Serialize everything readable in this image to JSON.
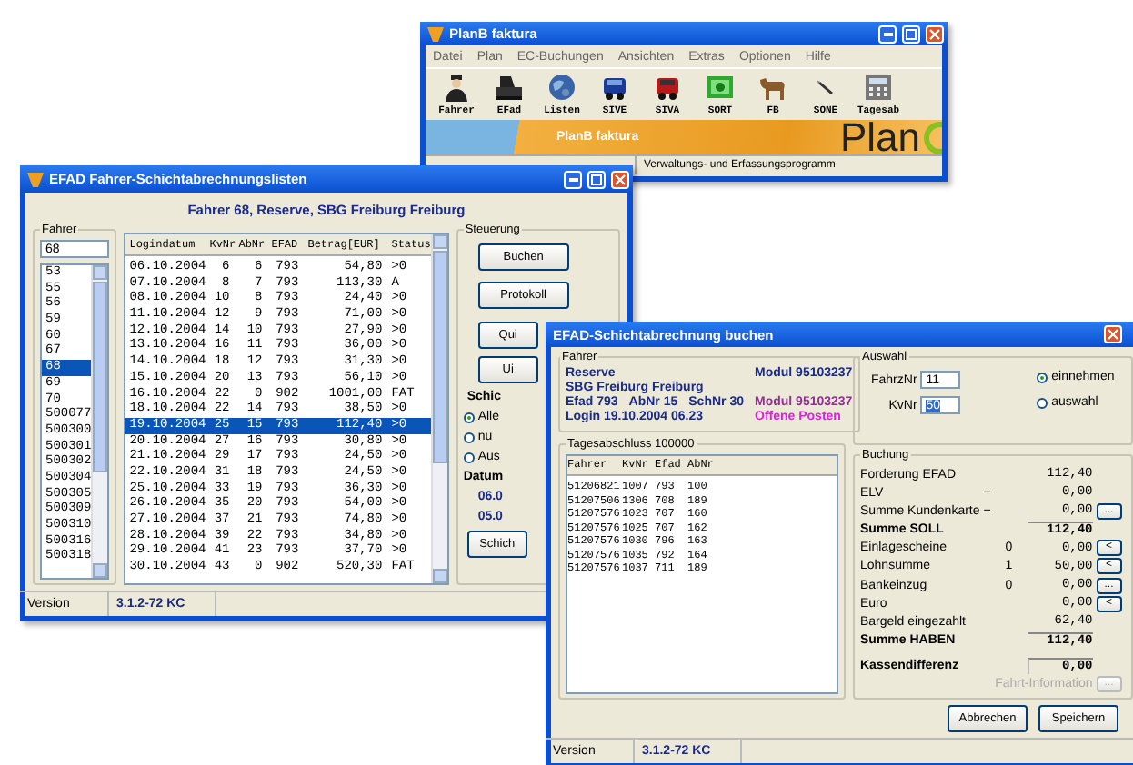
{
  "main_window": {
    "title": "PlanB faktura",
    "menu": [
      "Datei",
      "Plan",
      "EC-Buchungen",
      "Ansichten",
      "Extras",
      "Optionen",
      "Hilfe"
    ],
    "toolbar": [
      "Fahrer",
      "EFad",
      "Listen",
      "SIVE",
      "SIVA",
      "SORT",
      "FB",
      "SONE",
      "Tagesab"
    ],
    "banner_title": "PlanB faktura",
    "logo": "Plan",
    "status_text": "Verwaltungs- und Erfassungsprogramm"
  },
  "list_window": {
    "title": "EFAD Fahrer-Schichtabrechnungslisten",
    "header": "Fahrer 68,  Reserve, SBG Freiburg Freiburg",
    "driver_group": {
      "label": "Fahrer",
      "value": "68",
      "items": [
        {
          "label": "53",
          "selected": false
        },
        {
          "label": "55",
          "selected": false
        },
        {
          "label": "56",
          "selected": false
        },
        {
          "label": "59",
          "selected": false
        },
        {
          "label": "60",
          "selected": false
        },
        {
          "label": "67",
          "selected": false
        },
        {
          "label": "68",
          "selected": true
        },
        {
          "label": "69",
          "selected": false
        },
        {
          "label": "70",
          "selected": false
        },
        {
          "label": "500077",
          "selected": false
        },
        {
          "label": "500300",
          "selected": false
        },
        {
          "label": "500301",
          "selected": false
        },
        {
          "label": "500302",
          "selected": false
        },
        {
          "label": "500304",
          "selected": false
        },
        {
          "label": "500305",
          "selected": false
        },
        {
          "label": "500309",
          "selected": false
        },
        {
          "label": "500310",
          "selected": false
        },
        {
          "label": "500316",
          "selected": false
        },
        {
          "label": "500318",
          "selected": false
        }
      ]
    },
    "table": {
      "columns": [
        "Logindatum",
        "KvNr",
        "AbNr",
        "EFAD",
        "Betrag[EUR]",
        "Status"
      ],
      "rows": [
        {
          "cells": [
            "06.10.2004",
            "6",
            "6",
            "793",
            "54,80",
            ">0"
          ],
          "selected": false
        },
        {
          "cells": [
            "07.10.2004",
            "8",
            "7",
            "793",
            "113,30",
            "A"
          ],
          "selected": false
        },
        {
          "cells": [
            "08.10.2004",
            "10",
            "8",
            "793",
            "24,40",
            ">0"
          ],
          "selected": false
        },
        {
          "cells": [
            "11.10.2004",
            "12",
            "9",
            "793",
            "71,00",
            ">0"
          ],
          "selected": false
        },
        {
          "cells": [
            "12.10.2004",
            "14",
            "10",
            "793",
            "27,90",
            ">0"
          ],
          "selected": false
        },
        {
          "cells": [
            "13.10.2004",
            "16",
            "11",
            "793",
            "36,00",
            ">0"
          ],
          "selected": false
        },
        {
          "cells": [
            "14.10.2004",
            "18",
            "12",
            "793",
            "31,30",
            ">0"
          ],
          "selected": false
        },
        {
          "cells": [
            "15.10.2004",
            "20",
            "13",
            "793",
            "56,10",
            ">0"
          ],
          "selected": false
        },
        {
          "cells": [
            "16.10.2004",
            "22",
            "0",
            "902",
            "1001,00",
            "FAT"
          ],
          "selected": false
        },
        {
          "cells": [
            "18.10.2004",
            "22",
            "14",
            "793",
            "38,50",
            ">0"
          ],
          "selected": false
        },
        {
          "cells": [
            "19.10.2004",
            "25",
            "15",
            "793",
            "112,40",
            ">0"
          ],
          "selected": true
        },
        {
          "cells": [
            "20.10.2004",
            "27",
            "16",
            "793",
            "30,80",
            ">0"
          ],
          "selected": false
        },
        {
          "cells": [
            "21.10.2004",
            "29",
            "17",
            "793",
            "24,50",
            ">0"
          ],
          "selected": false
        },
        {
          "cells": [
            "22.10.2004",
            "31",
            "18",
            "793",
            "24,50",
            ">0"
          ],
          "selected": false
        },
        {
          "cells": [
            "25.10.2004",
            "33",
            "19",
            "793",
            "36,30",
            ">0"
          ],
          "selected": false
        },
        {
          "cells": [
            "26.10.2004",
            "35",
            "20",
            "793",
            "54,00",
            ">0"
          ],
          "selected": false
        },
        {
          "cells": [
            "27.10.2004",
            "37",
            "21",
            "793",
            "74,80",
            ">0"
          ],
          "selected": false
        },
        {
          "cells": [
            "28.10.2004",
            "39",
            "22",
            "793",
            "34,80",
            ">0"
          ],
          "selected": false
        },
        {
          "cells": [
            "29.10.2004",
            "41",
            "23",
            "793",
            "37,70",
            ">0"
          ],
          "selected": false
        },
        {
          "cells": [
            "30.10.2004",
            "43",
            "0",
            "902",
            "520,30",
            "FAT"
          ],
          "selected": false
        }
      ]
    },
    "control_group": {
      "label": "Steuerung",
      "buttons": [
        "Buchen",
        "Protokoll",
        "Qui",
        "Ui"
      ],
      "filter_label": "Schic",
      "filter_options": [
        {
          "label": "Alle",
          "selected": true
        },
        {
          "label": "nu",
          "selected": false
        },
        {
          "label": "Aus",
          "selected": false
        }
      ],
      "date_label": "Datum",
      "dates": [
        "06.0",
        "05.0"
      ],
      "bottom_button": "Schich"
    },
    "status": {
      "label": "Version",
      "version": "3.1.2-72 KC"
    }
  },
  "booking_window": {
    "title": "EFAD-Schichtabrechnung buchen",
    "driver_group": {
      "label": "Fahrer",
      "name": "Reserve",
      "company": "SBG Freiburg Freiburg",
      "details": [
        "Efad 793",
        "AbNr 15",
        "SchNr 30"
      ],
      "login": "Login  19.10.2004  06.23",
      "module": "Modul 95103237",
      "module_2": "Modul 95103237",
      "open_items": "Offene Posten"
    },
    "shift_group": {
      "label": "Tagesabschluss 100000",
      "columns": [
        "Fahrer",
        "KvNr",
        "Efad",
        "AbNr"
      ],
      "rows": [
        [
          "51206821",
          "1007",
          "793",
          "100"
        ],
        [
          "51207506",
          "1306",
          "708",
          "189"
        ],
        [
          "51207576",
          "1023",
          "707",
          "160"
        ],
        [
          "51207576",
          "1025",
          "707",
          "162"
        ],
        [
          "51207576",
          "1030",
          "796",
          "163"
        ],
        [
          "51207576",
          "1035",
          "792",
          "164"
        ],
        [
          "51207576",
          "1037",
          "711",
          "189"
        ]
      ]
    },
    "selection_group": {
      "label": "Auswahl",
      "fields": [
        {
          "label": "FahrzNr",
          "value": "11",
          "highlighted": false
        },
        {
          "label": "KvNr",
          "value": "50",
          "highlighted": true
        }
      ],
      "options": [
        {
          "label": "einnehmen",
          "selected": true
        },
        {
          "label": "auswahl",
          "selected": false
        }
      ]
    },
    "booking_group": {
      "label": "Buchung",
      "rows": [
        {
          "kind": "line",
          "label": "Forderung EFAD",
          "sign": "",
          "count": "",
          "amount": "112,40",
          "action": ""
        },
        {
          "kind": "line",
          "label": "ELV",
          "sign": "−",
          "count": "",
          "amount": "0,00",
          "action": ""
        },
        {
          "kind": "line",
          "label": "Summe Kundenkarte",
          "sign": "−",
          "count": "",
          "amount": "0,00",
          "action": "..."
        },
        {
          "kind": "sum",
          "label": "Summe SOLL",
          "sign": "",
          "count": "",
          "amount": "112,40",
          "action": ""
        },
        {
          "kind": "line",
          "label": "Einlagescheine",
          "sign": "",
          "count": "0",
          "amount": "0,00",
          "action": "<"
        },
        {
          "kind": "line",
          "label": "Lohnsumme",
          "sign": "",
          "count": "1",
          "amount": "50,00",
          "action": "<"
        },
        {
          "kind": "line",
          "label": "Bankeinzug",
          "sign": "",
          "count": "0",
          "amount": "0,00",
          "action": "..."
        },
        {
          "kind": "line",
          "label": "Euro",
          "sign": "",
          "count": "",
          "amount": "0,00",
          "action": "<"
        },
        {
          "kind": "line",
          "label": "Bargeld eingezahlt",
          "sign": "",
          "count": "",
          "amount": "62,40",
          "action": ""
        },
        {
          "kind": "sum",
          "label": "Summe HABEN",
          "sign": "",
          "count": "",
          "amount": "112,40",
          "action": ""
        },
        {
          "kind": "total",
          "label": "Kassendifferenz",
          "sign": "",
          "count": "",
          "amount": "0,00",
          "action": ""
        },
        {
          "kind": "disabled",
          "label": "Fahrt-Information",
          "sign": "",
          "count": "",
          "amount": "",
          "action": "..."
        }
      ]
    },
    "buttons": [
      "Abbrechen",
      "Speichern"
    ],
    "status": {
      "label": "Version",
      "version": "3.1.2-72 KC"
    }
  }
}
